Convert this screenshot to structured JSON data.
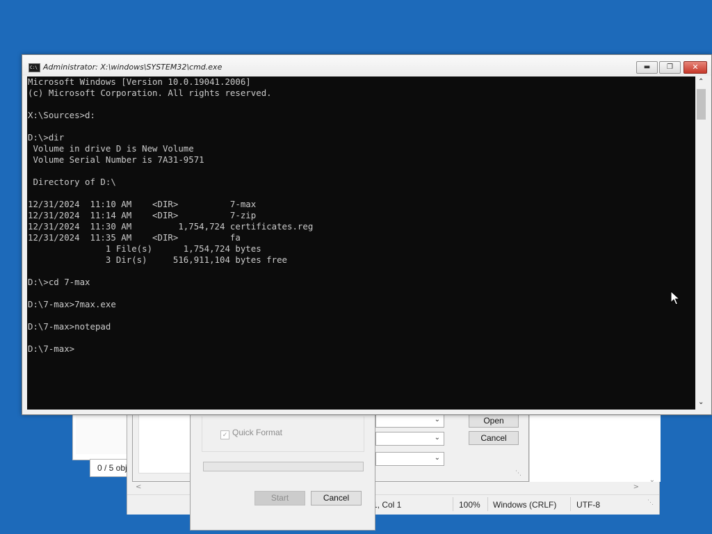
{
  "desktop": {
    "background": "#1d6aba"
  },
  "explorer": {
    "status_text": "0 / 5 obj"
  },
  "open_dialog": {
    "open_label": "Open",
    "cancel_label": "Cancel"
  },
  "notepad": {
    "position": "1, Col 1",
    "zoom": "100%",
    "line_ending": "Windows (CRLF)",
    "encoding": "UTF-8"
  },
  "format_dialog": {
    "quick_format_label": "Quick Format",
    "quick_format_checked": true,
    "progress": 0,
    "start_label": "Start",
    "cancel_label": "Cancel"
  },
  "cmd": {
    "title": "Administrator: X:\\windows\\SYSTEM32\\cmd.exe",
    "icon": "cmd-icon",
    "console_text": "Microsoft Windows [Version 10.0.19041.2006]\n(c) Microsoft Corporation. All rights reserved.\n\nX:\\Sources>d:\n\nD:\\>dir\n Volume in drive D is New Volume\n Volume Serial Number is 7A31-9571\n\n Directory of D:\\\n\n12/31/2024  11:10 AM    <DIR>          7-max\n12/31/2024  11:14 AM    <DIR>          7-zip\n12/31/2024  11:30 AM         1,754,724 certificates.reg\n12/31/2024  11:35 AM    <DIR>          fa\n               1 File(s)      1,754,724 bytes\n               3 Dir(s)     516,911,104 bytes free\n\nD:\\>cd 7-max\n\nD:\\7-max>7max.exe\n\nD:\\7-max>notepad\n\nD:\\7-max>",
    "colors": {
      "background": "#0c0c0c",
      "foreground": "#cccccc",
      "close_button": "#c6382a"
    }
  }
}
